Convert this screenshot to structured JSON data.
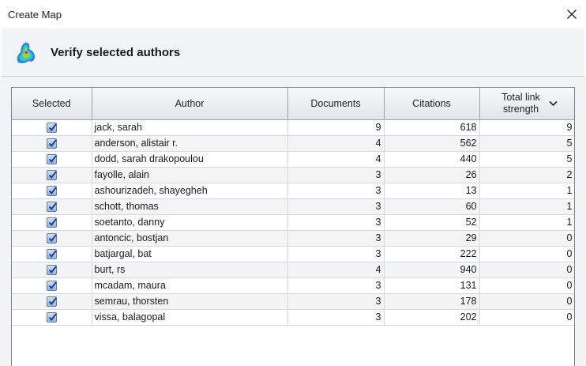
{
  "window": {
    "title": "Create Map"
  },
  "header": {
    "heading": "Verify selected authors"
  },
  "table": {
    "columns": {
      "selected": "Selected",
      "author": "Author",
      "documents": "Documents",
      "citations": "Citations",
      "link_strength_line1": "Total link",
      "link_strength_line2": "strength"
    },
    "rows": [
      {
        "selected": true,
        "author": "jack, sarah",
        "documents": "9",
        "citations": "618",
        "link_strength": "9"
      },
      {
        "selected": true,
        "author": "anderson, alistair r.",
        "documents": "4",
        "citations": "562",
        "link_strength": "5"
      },
      {
        "selected": true,
        "author": "dodd, sarah drakopoulou",
        "documents": "4",
        "citations": "440",
        "link_strength": "5"
      },
      {
        "selected": true,
        "author": "fayolle, alain",
        "documents": "3",
        "citations": "26",
        "link_strength": "2"
      },
      {
        "selected": true,
        "author": "ashourizadeh, shayegheh",
        "documents": "3",
        "citations": "13",
        "link_strength": "1"
      },
      {
        "selected": true,
        "author": "schott, thomas",
        "documents": "3",
        "citations": "60",
        "link_strength": "1"
      },
      {
        "selected": true,
        "author": "soetanto, danny",
        "documents": "3",
        "citations": "52",
        "link_strength": "1"
      },
      {
        "selected": true,
        "author": "antoncic, bostjan",
        "documents": "3",
        "citations": "29",
        "link_strength": "0"
      },
      {
        "selected": true,
        "author": "batjargal, bat",
        "documents": "3",
        "citations": "222",
        "link_strength": "0"
      },
      {
        "selected": true,
        "author": "burt, rs",
        "documents": "4",
        "citations": "940",
        "link_strength": "0"
      },
      {
        "selected": true,
        "author": "mcadam, maura",
        "documents": "3",
        "citations": "131",
        "link_strength": "0"
      },
      {
        "selected": true,
        "author": "semrau, thorsten",
        "documents": "3",
        "citations": "178",
        "link_strength": "0"
      },
      {
        "selected": true,
        "author": "vissa, balagopal",
        "documents": "3",
        "citations": "202",
        "link_strength": "0"
      }
    ]
  },
  "colors": {
    "accent_check": "#2a5aa8",
    "header_bg": "#f1f3f6",
    "grid_border": "#7d8189"
  },
  "icons": {
    "close": "close-icon",
    "app": "heatmap-logo-icon",
    "sort": "chevron-down-icon",
    "check": "checkmark-icon"
  }
}
